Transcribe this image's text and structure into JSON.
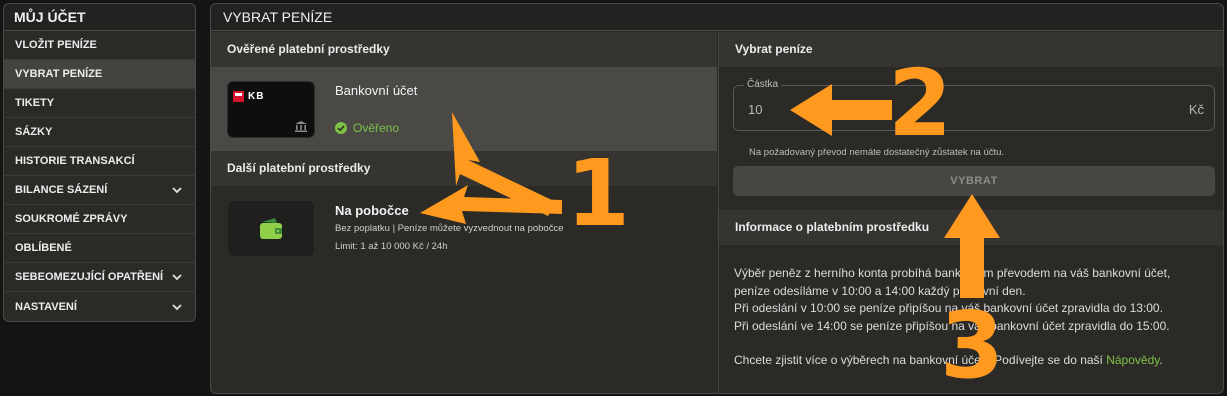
{
  "sidebar": {
    "title": "MŮJ ÚČET",
    "items": [
      {
        "label": "VLOŽIT PENÍZE",
        "chevron": false
      },
      {
        "label": "VYBRAT PENÍZE",
        "chevron": false,
        "active": true
      },
      {
        "label": "TIKETY",
        "chevron": false
      },
      {
        "label": "SÁZKY",
        "chevron": false
      },
      {
        "label": "HISTORIE TRANSAKCÍ",
        "chevron": false
      },
      {
        "label": "BILANCE SÁZENÍ",
        "chevron": true
      },
      {
        "label": "SOUKROMÉ ZPRÁVY",
        "chevron": false
      },
      {
        "label": "OBLÍBENÉ",
        "chevron": false
      },
      {
        "label": "SEBEOMEZUJÍCÍ OPATŘENÍ",
        "chevron": true
      },
      {
        "label": "NASTAVENÍ",
        "chevron": true
      }
    ]
  },
  "main": {
    "title": "VYBRAT PENÍZE",
    "verified_section": "Ověřené platební prostředky",
    "bank": {
      "card_logo": "KB",
      "name": "Bankovní účet",
      "status": "Ověřeno"
    },
    "other_section": "Další platební prostředky",
    "branch": {
      "name": "Na pobočce",
      "line1": "Bez poplatku | Peníze můžete vyzvednout na pobočce",
      "line2": "Limit: 1 až 10 000 Kč / 24h"
    }
  },
  "withdraw": {
    "heading": "Vybrat peníze",
    "amount_label": "Částka",
    "amount_value": "10",
    "amount_unit": "Kč",
    "warning": "Na požadovaný převod nemáte dostatečný zůstatek na účtu.",
    "button": "VYBRAT"
  },
  "info": {
    "heading": "Informace o platebním prostředku",
    "p1_line1": "Výběr peněz z herního konta probíhá bankovním převodem na váš bankovní účet,",
    "p1_line2": "peníze odesíláme v 10:00 a 14:00 každý pracovní den.",
    "p1_line3": "Při odeslání v 10:00 se peníze připíšou na váš bankovní účet zpravidla do 13:00.",
    "p1_line4": "Při odeslání ve 14:00 se peníze připíšou na váš bankovní účet zpravidla do 15:00.",
    "p2_text": "Chcete zjistit více o výběrech na bankovní účet? Podívejte se do naší ",
    "p2_link": "Nápovědy",
    "p2_end": "."
  },
  "annotations": {
    "one": "1",
    "two": "2",
    "three": "3",
    "color": "#ff9a1f"
  },
  "colors": {
    "accent_green": "#7cc246",
    "panel": "#2b2a27",
    "background": "#141414"
  }
}
